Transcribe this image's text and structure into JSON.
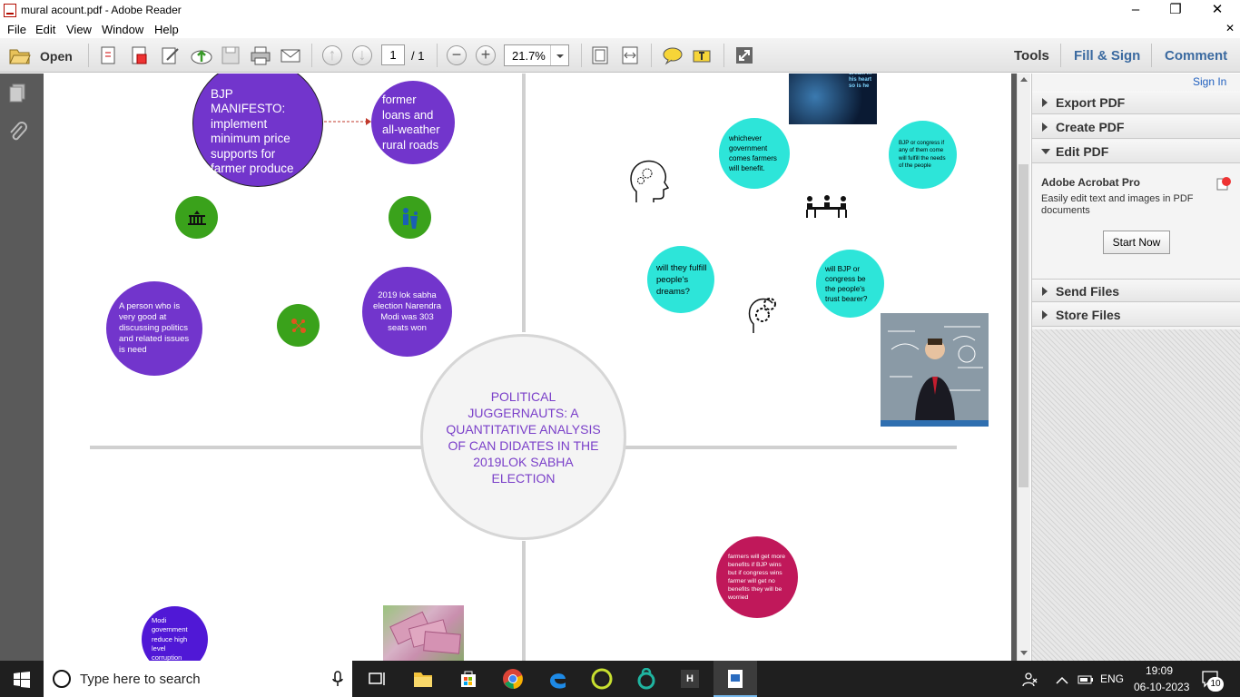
{
  "window": {
    "title": "mural acount.pdf - Adobe Reader",
    "minimize": "–",
    "maximize": "❐",
    "close": "✕",
    "close_doc": "✕"
  },
  "menu": [
    "File",
    "Edit",
    "View",
    "Window",
    "Help"
  ],
  "toolbar": {
    "open": "Open",
    "page_current": "1",
    "page_total": "/ 1",
    "zoom": "21.7%",
    "tools": "Tools",
    "fill_sign": "Fill & Sign",
    "comment": "Comment"
  },
  "right_panel": {
    "sign_in": "Sign In",
    "sections": [
      "Export PDF",
      "Create PDF",
      "Edit PDF",
      "Send Files",
      "Store Files"
    ],
    "promo_title": "Adobe Acrobat Pro",
    "promo_desc": "Easily edit text and images in PDF documents",
    "start_now": "Start Now"
  },
  "colors": {
    "purple": "#7235cc",
    "teal": "#2de5d9",
    "green": "#3aa21b",
    "magenta": "#c0185a",
    "center_text": "#7a3fc9",
    "modi": "#5018d6"
  },
  "mural": {
    "center": "POLITICAL JUGGERNAUTS: A QUANTITATIVE ANALYSIS OF CAN DIDATES IN THE 2019LOK SABHA ELECTION",
    "manifesto": "BJP MANIFESTO: implement minimum price supports for farmer produce",
    "former_loans": "former loans and all-weather rural roads",
    "person": "A person who is very good  at discussing politics and related issues is need",
    "election": "2019 lok sabha election Narendra Modi was 303 seats won",
    "whichever": "whichever government comes farmers will benefit.",
    "bjp_congress_fulfill": "BJP or congress if any of them come will fulfill the needs of the people",
    "will_they": "will they fulfill people's dreams?",
    "trust": "will BJP or congress be the people's trust bearer?",
    "farmers": "farmers will get more benefits if BJP wins but if congress wins farmer will get no  benefits they will be worried",
    "modi_corruption": "Modi government reduce high level corruption",
    "ai_image_text": "dream in his heart so is he"
  },
  "taskbar": {
    "search_placeholder": "Type here to search",
    "time": "19:09",
    "date": "06-10-2023",
    "lang": "ENG",
    "notif_count": "10"
  }
}
